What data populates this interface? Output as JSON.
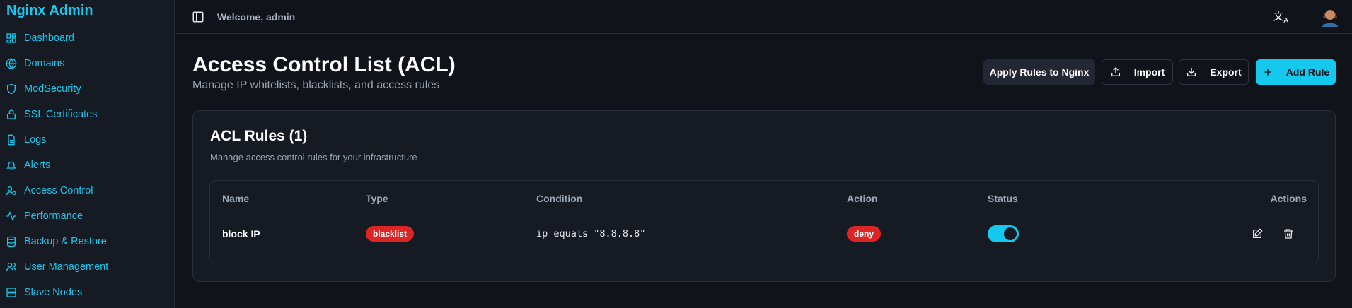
{
  "sidebar": {
    "brand": "Nginx Admin",
    "items": [
      {
        "label": "Dashboard",
        "icon": "dashboard-icon"
      },
      {
        "label": "Domains",
        "icon": "globe-icon"
      },
      {
        "label": "ModSecurity",
        "icon": "shield-icon"
      },
      {
        "label": "SSL Certificates",
        "icon": "lock-icon"
      },
      {
        "label": "Logs",
        "icon": "file-icon"
      },
      {
        "label": "Alerts",
        "icon": "bell-icon"
      },
      {
        "label": "Access Control",
        "icon": "user-key-icon"
      },
      {
        "label": "Performance",
        "icon": "activity-icon"
      },
      {
        "label": "Backup & Restore",
        "icon": "database-icon"
      },
      {
        "label": "User Management",
        "icon": "users-icon"
      },
      {
        "label": "Slave Nodes",
        "icon": "server-icon"
      }
    ]
  },
  "header": {
    "welcome": "Welcome, admin"
  },
  "page": {
    "title": "Access Control List (ACL)",
    "subtitle": "Manage IP whitelists, blacklists, and access rules",
    "buttons": {
      "apply": "Apply Rules to Nginx",
      "import": "Import",
      "export": "Export",
      "add": "Add Rule"
    }
  },
  "card": {
    "title": "ACL Rules (1)",
    "description": "Manage access control rules for your infrastructure",
    "columns": [
      "Name",
      "Type",
      "Condition",
      "Action",
      "Status",
      "Actions"
    ],
    "rows": [
      {
        "name": "block IP",
        "type": "blacklist",
        "condition": "ip equals \"8.8.8.8\"",
        "action": "deny",
        "enabled": true
      }
    ]
  },
  "colors": {
    "accent": "#14c8ee",
    "danger": "#dc2626"
  }
}
